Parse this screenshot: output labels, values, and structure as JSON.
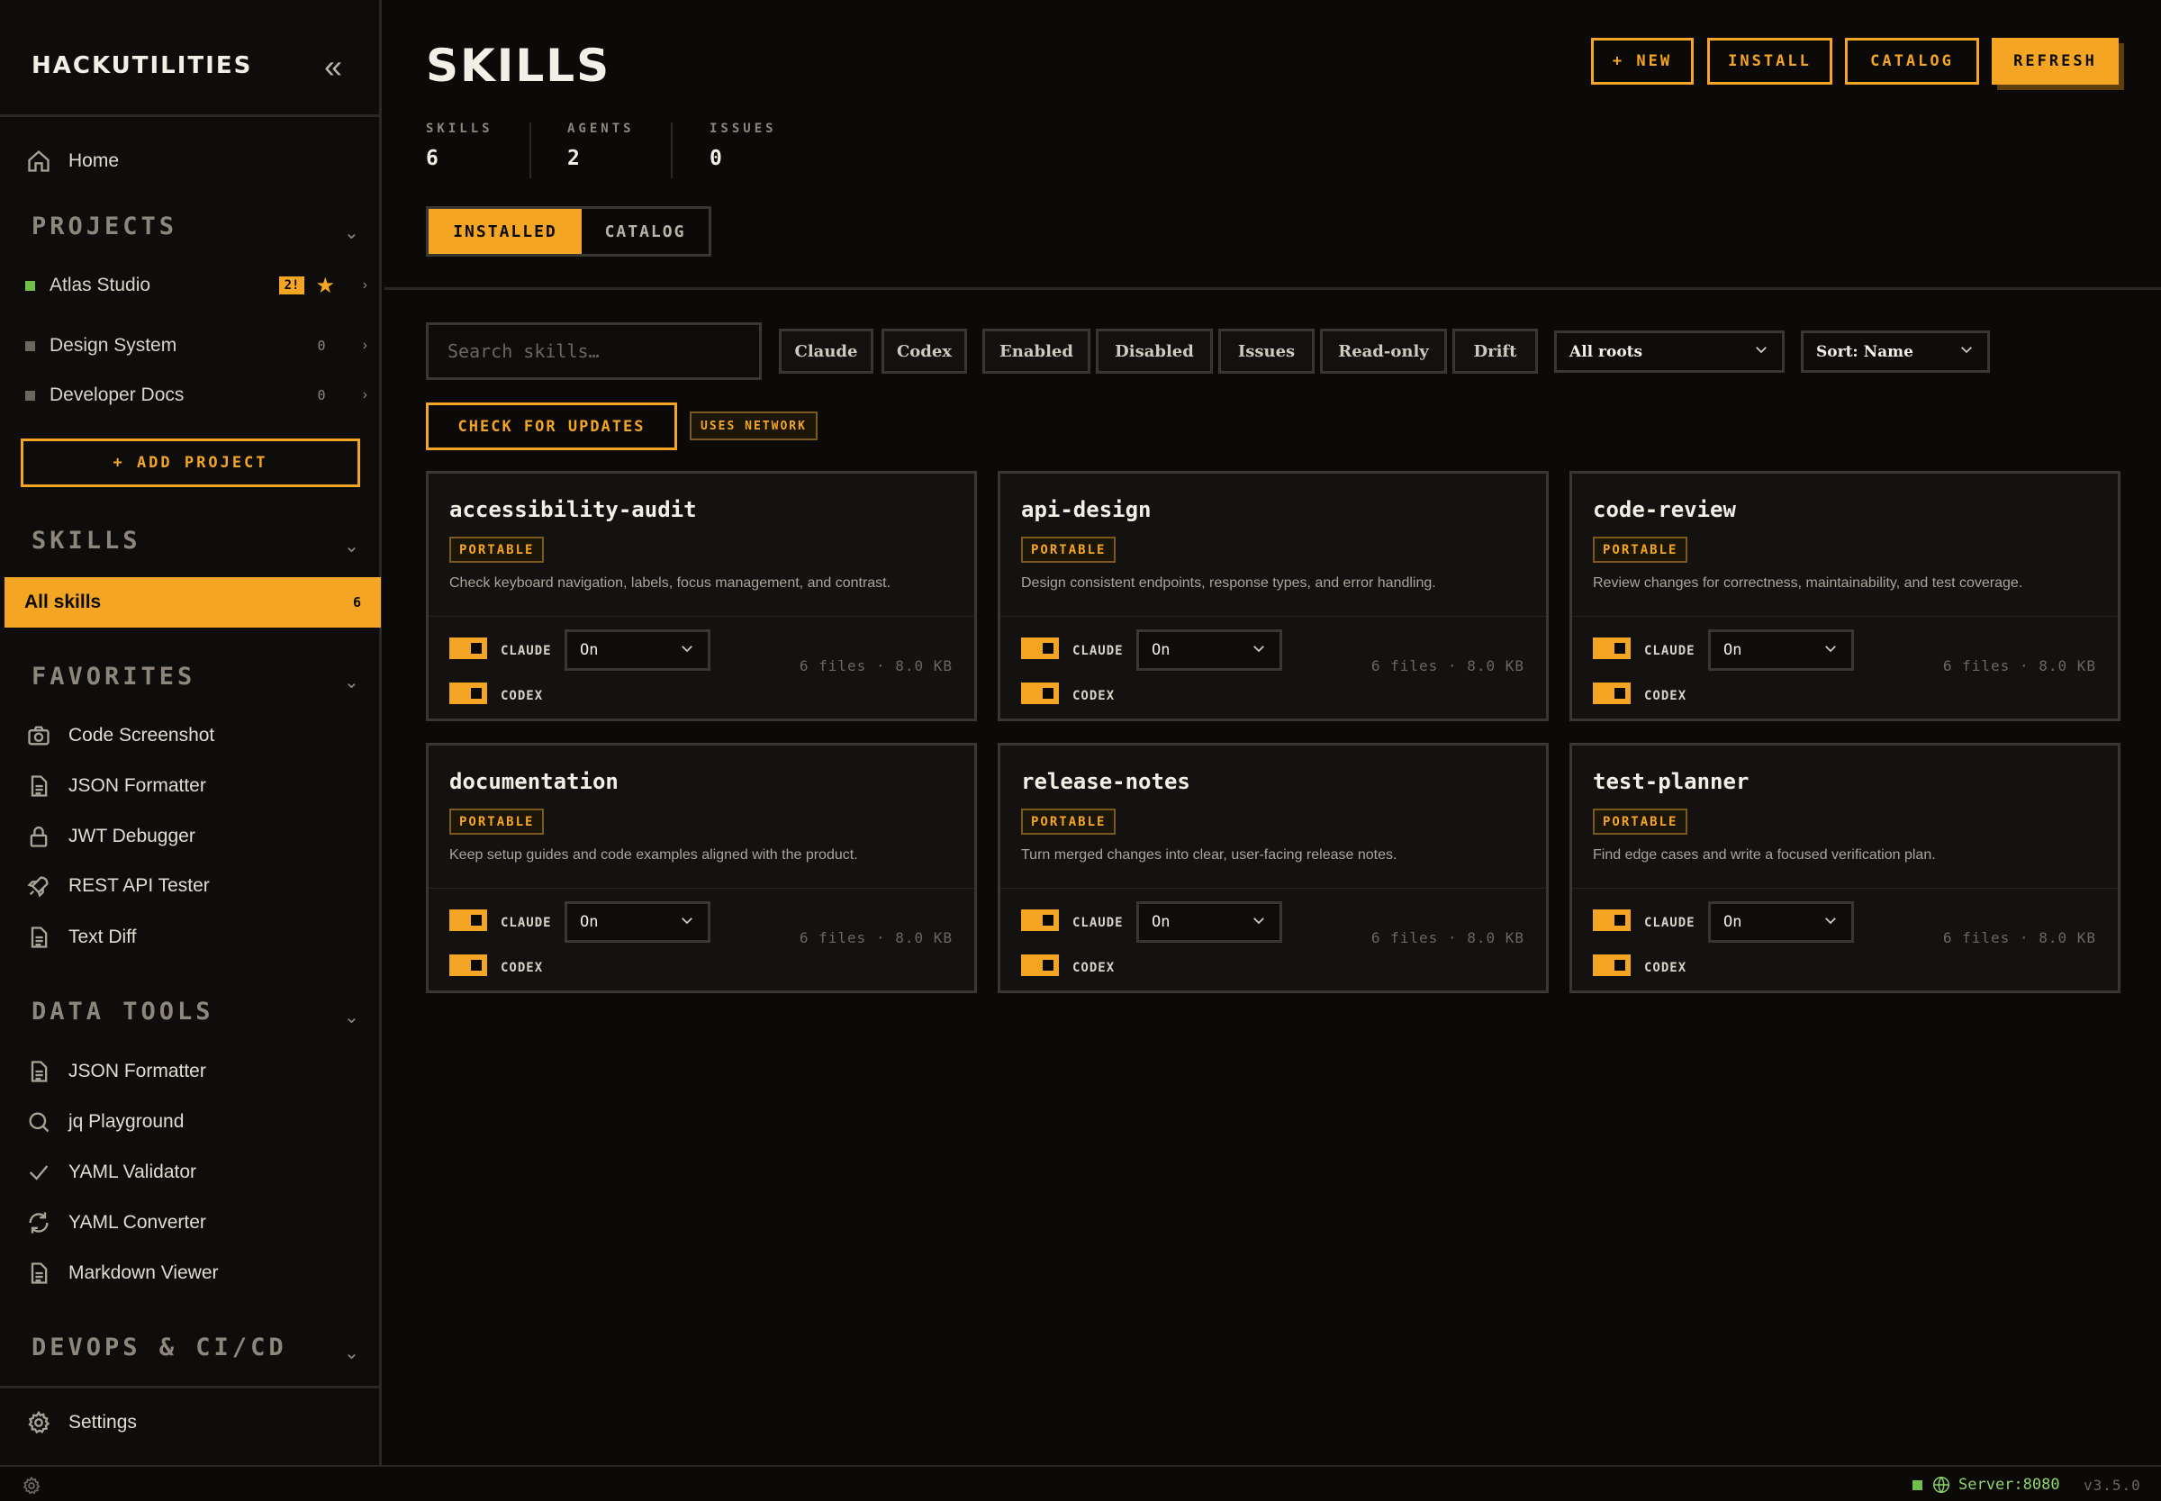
{
  "sidebar": {
    "brand": "HACKUTILITIES",
    "home": "Home",
    "projects_title": "PROJECTS",
    "projects": [
      {
        "name": "Atlas Studio",
        "badge": "2!",
        "active": true
      },
      {
        "name": "Design System",
        "count": "0"
      },
      {
        "name": "Developer Docs",
        "count": "0"
      }
    ],
    "add_project": "+ ADD PROJECT",
    "skills_title": "SKILLS",
    "all_skills": {
      "label": "All skills",
      "count": "6"
    },
    "favorites_title": "FAVORITES",
    "favorites": [
      {
        "label": "Code Screenshot",
        "icon": "camera-icon"
      },
      {
        "label": "JSON Formatter",
        "icon": "document-icon"
      },
      {
        "label": "JWT Debugger",
        "icon": "lock-icon"
      },
      {
        "label": "REST API Tester",
        "icon": "rocket-icon"
      },
      {
        "label": "Text Diff",
        "icon": "document-icon"
      }
    ],
    "data_tools_title": "DATA TOOLS",
    "data_tools": [
      {
        "label": "JSON Formatter",
        "icon": "document-icon"
      },
      {
        "label": "jq Playground",
        "icon": "search-icon"
      },
      {
        "label": "YAML Validator",
        "icon": "check-icon"
      },
      {
        "label": "YAML Converter",
        "icon": "refresh-icon"
      },
      {
        "label": "Markdown Viewer",
        "icon": "document-icon"
      }
    ],
    "devops_title": "DEVOPS & CI/CD",
    "settings": "Settings"
  },
  "header": {
    "title": "SKILLS",
    "buttons": {
      "new": "+ NEW",
      "install": "INSTALL",
      "catalog": "CATALOG",
      "refresh": "REFRESH"
    },
    "stats": [
      {
        "label": "SKILLS",
        "value": "6"
      },
      {
        "label": "AGENTS",
        "value": "2"
      },
      {
        "label": "ISSUES",
        "value": "0"
      }
    ],
    "tabs": {
      "installed": "INSTALLED",
      "catalog": "CATALOG"
    }
  },
  "filters": {
    "search_placeholder": "Search skills…",
    "chips": [
      "Claude",
      "Codex",
      "Enabled",
      "Disabled",
      "Issues",
      "Read-only",
      "Drift"
    ],
    "roots": "All roots",
    "sort": "Sort: Name",
    "check_updates": "CHECK FOR UPDATES",
    "uses_network": "USES NETWORK"
  },
  "skills": [
    {
      "name": "accessibility-audit",
      "tag": "PORTABLE",
      "desc": "Check keyboard navigation, labels, focus management, and contrast.",
      "claude": "CLAUDE",
      "codex": "CODEX",
      "mode": "On",
      "meta": "6 files · 8.0 KB"
    },
    {
      "name": "api-design",
      "tag": "PORTABLE",
      "desc": "Design consistent endpoints, response types, and error handling.",
      "claude": "CLAUDE",
      "codex": "CODEX",
      "mode": "On",
      "meta": "6 files · 8.0 KB"
    },
    {
      "name": "code-review",
      "tag": "PORTABLE",
      "desc": "Review changes for correctness, maintainability, and test coverage.",
      "claude": "CLAUDE",
      "codex": "CODEX",
      "mode": "On",
      "meta": "6 files · 8.0 KB"
    },
    {
      "name": "documentation",
      "tag": "PORTABLE",
      "desc": "Keep setup guides and code examples aligned with the product.",
      "claude": "CLAUDE",
      "codex": "CODEX",
      "mode": "On",
      "meta": "6 files · 8.0 KB"
    },
    {
      "name": "release-notes",
      "tag": "PORTABLE",
      "desc": "Turn merged changes into clear, user-facing release notes.",
      "claude": "CLAUDE",
      "codex": "CODEX",
      "mode": "On",
      "meta": "6 files · 8.0 KB"
    },
    {
      "name": "test-planner",
      "tag": "PORTABLE",
      "desc": "Find edge cases and write a focused verification plan.",
      "claude": "CLAUDE",
      "codex": "CODEX",
      "mode": "On",
      "meta": "6 files · 8.0 KB"
    }
  ],
  "status": {
    "server": "Server:8080",
    "version": "v3.5.0"
  },
  "colors": {
    "accent": "#f5a524",
    "background": "#0b0a09",
    "online": "#6fbf4a"
  }
}
